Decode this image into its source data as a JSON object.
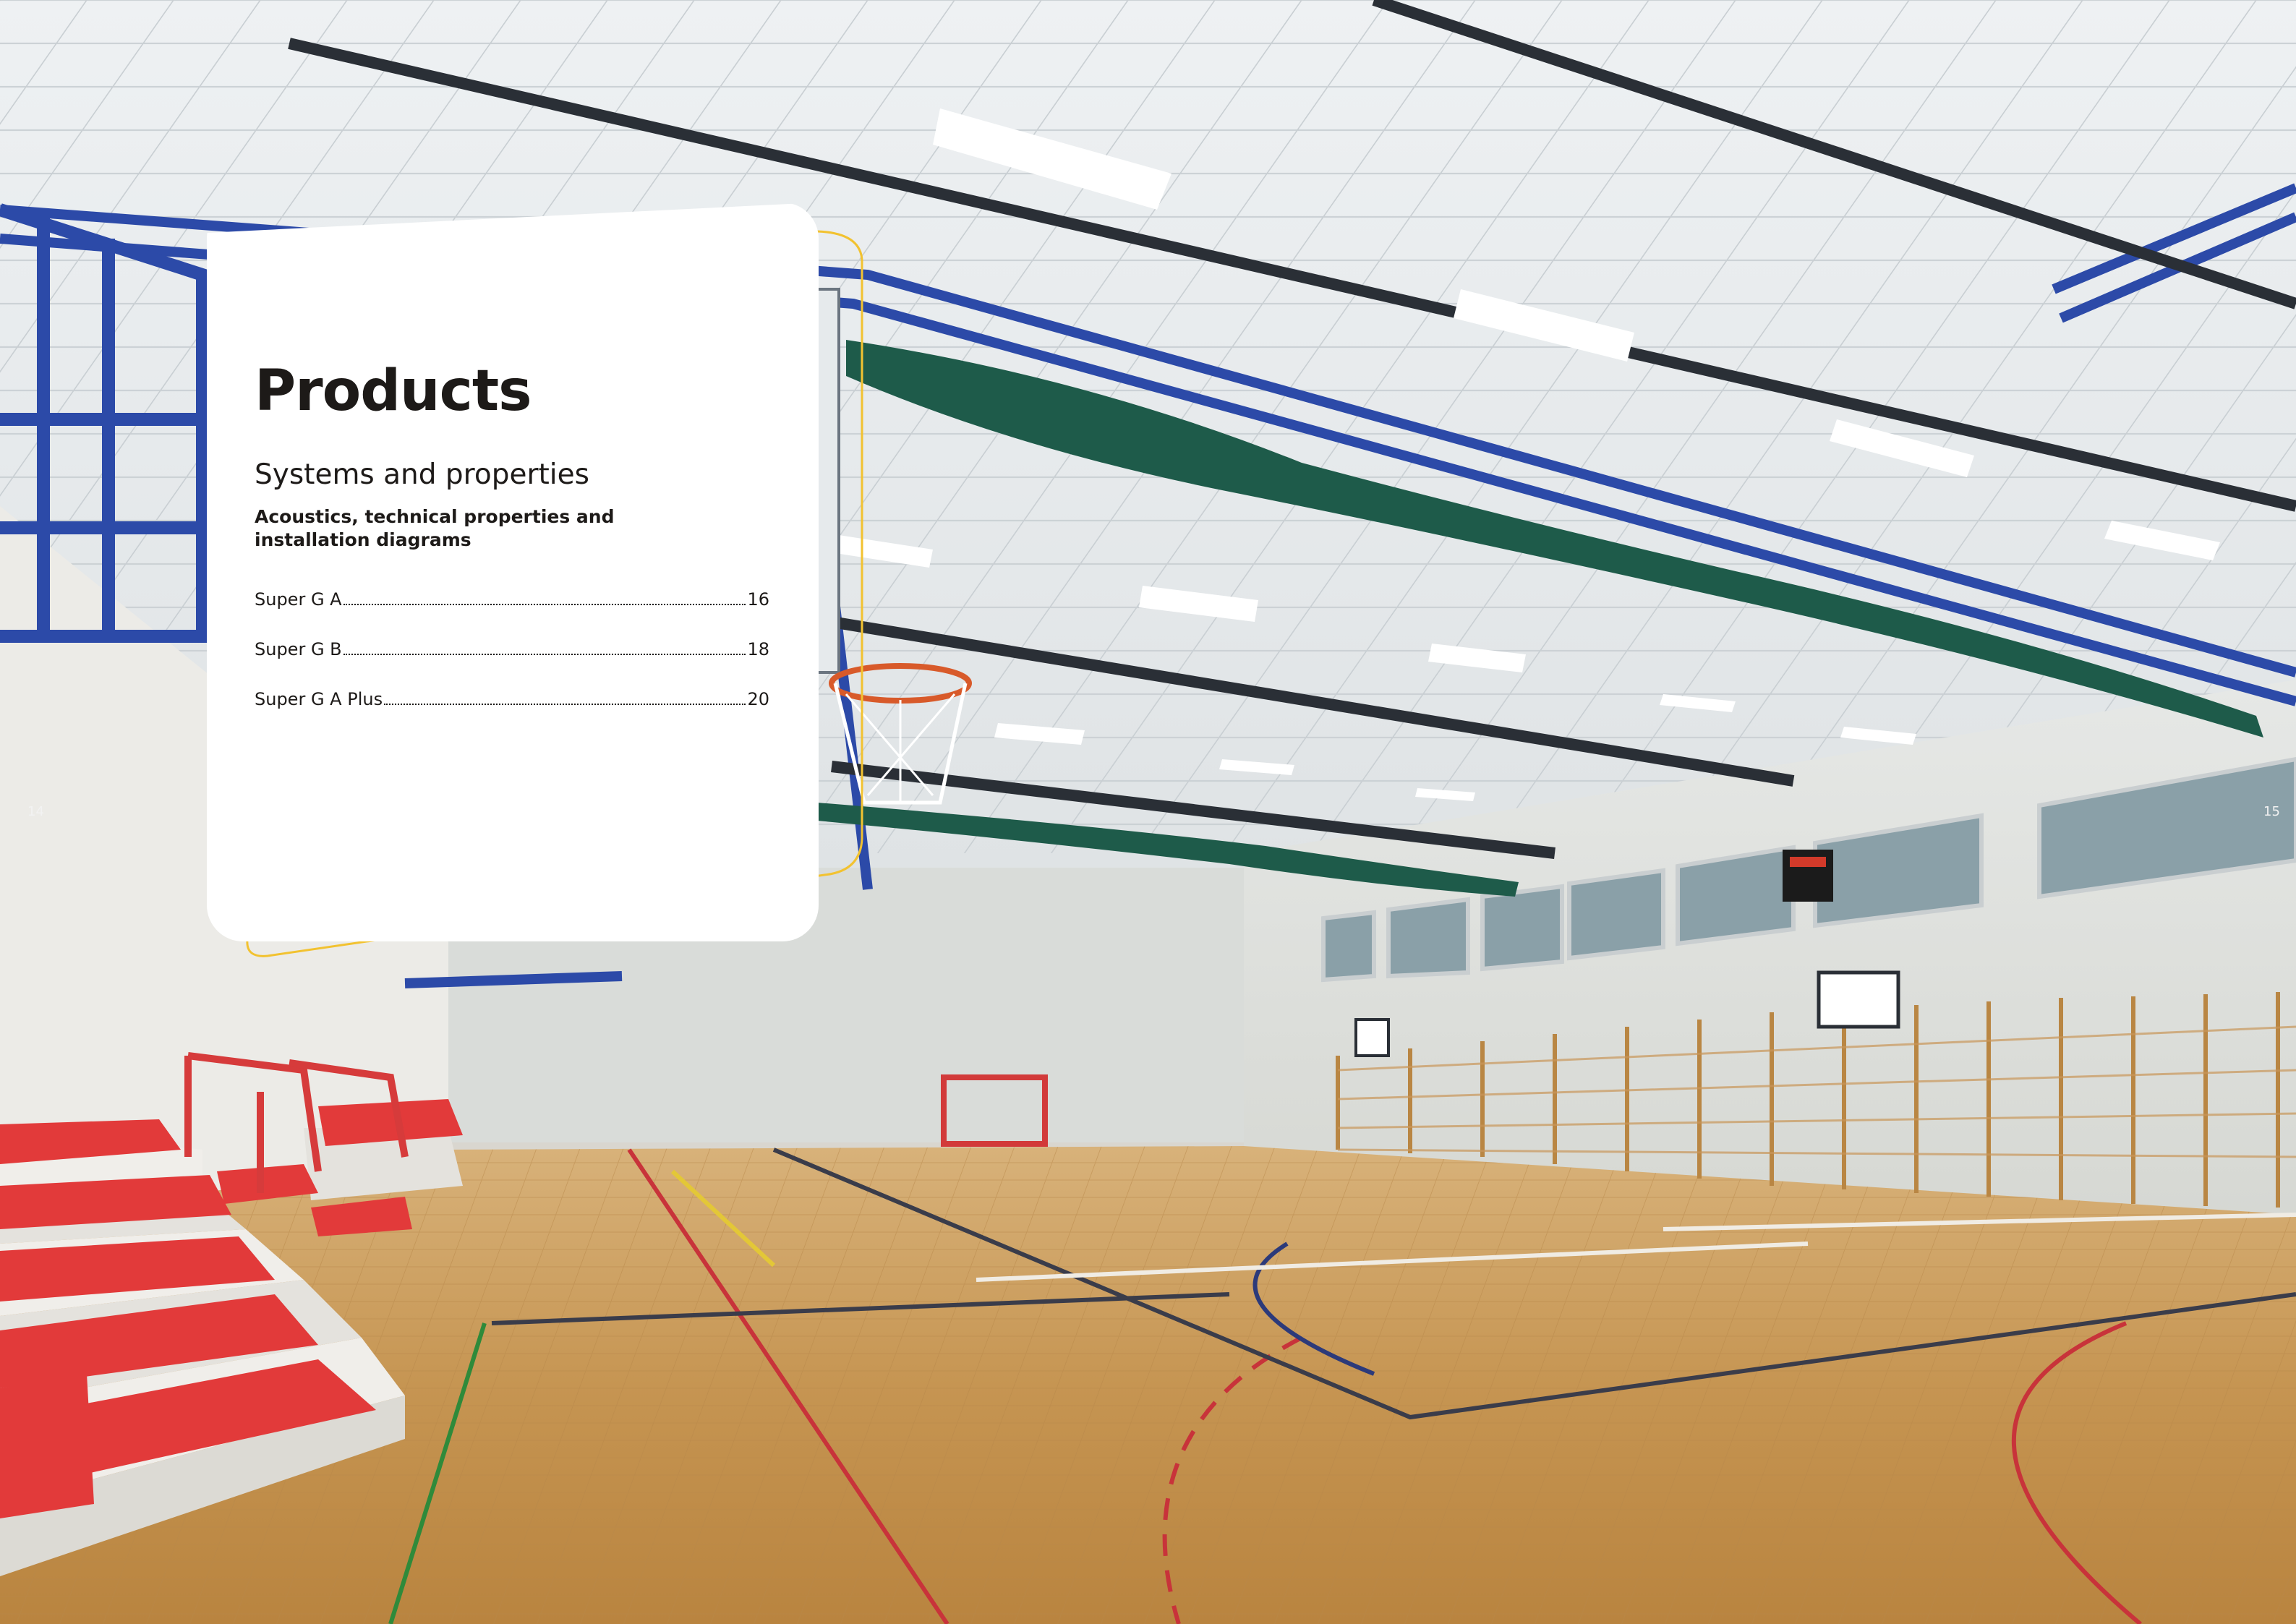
{
  "section": {
    "title": "Products",
    "subtitle": "Systems and properties",
    "description": "Acoustics, technical properties and installation diagrams"
  },
  "toc": [
    {
      "label": "Super G A",
      "page": "16"
    },
    {
      "label": "Super G B",
      "page": "18"
    },
    {
      "label": "Super G A Plus",
      "page": "20"
    }
  ],
  "page_numbers": {
    "left": "14",
    "right": "15"
  },
  "colors": {
    "accent": "#f2c230",
    "court_red": "#d63b3b",
    "seat_red": "#e23a3a",
    "floor": "#c99b5a",
    "frame_blue": "#2c4aa8"
  }
}
